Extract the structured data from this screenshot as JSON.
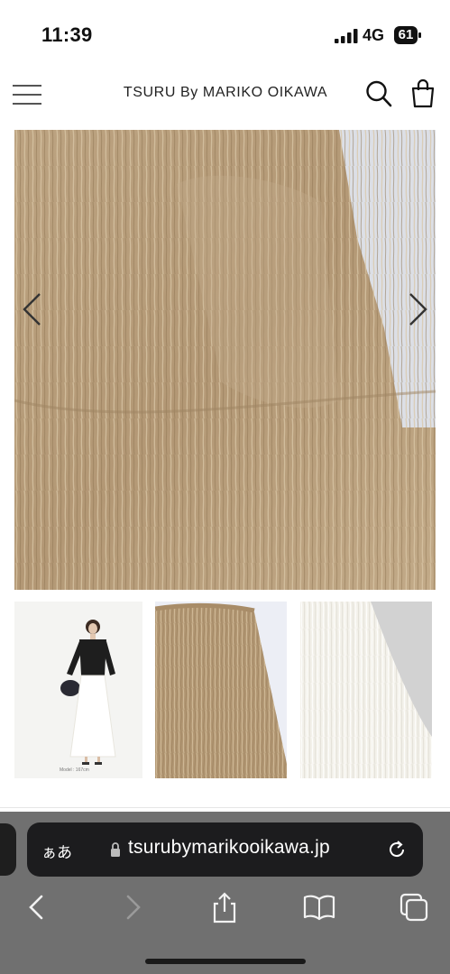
{
  "status_bar": {
    "time": "11:39",
    "network": "4G",
    "battery": "61",
    "icons": {
      "signal": "signal-bars-icon",
      "battery": "battery-icon"
    }
  },
  "header": {
    "brand": "TSURU By MARIKO OIKAWA",
    "icons": {
      "menu": "hamburger-menu-icon",
      "search": "search-icon",
      "cart": "shopping-bag-icon"
    }
  },
  "gallery": {
    "hero": {
      "description_icon": "product-photo-beige-fringe-skirt",
      "prev_icon": "chevron-left-icon",
      "next_icon": "chevron-right-icon"
    },
    "thumbnails": [
      {
        "icon": "model-wearing-skirt-photo",
        "caption": "Model : 167cm"
      },
      {
        "icon": "beige-skirt-flat-photo"
      },
      {
        "icon": "white-skirt-closeup-photo"
      }
    ]
  },
  "browser": {
    "text_size_label": "ぁあ",
    "url": "tsurubymarikooikawa.jp",
    "icons": {
      "lock": "lock-icon",
      "reload": "reload-icon",
      "back": "chevron-left-icon",
      "forward": "chevron-right-icon",
      "share": "share-icon",
      "bookmarks": "book-icon",
      "tabs": "tabs-icon"
    },
    "colors": {
      "chrome": "#707070",
      "address_bar": "#1c1c1e"
    }
  },
  "colors": {
    "skirt_beige": "#b59b78",
    "background": "#ffffff"
  }
}
